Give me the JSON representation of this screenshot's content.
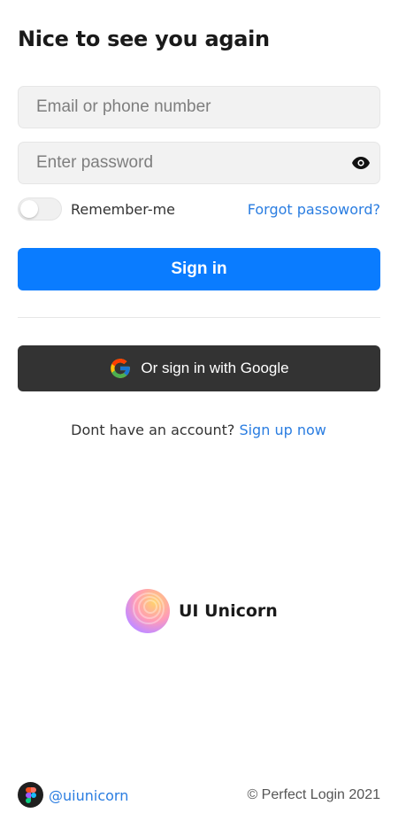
{
  "title": "Nice to see you again",
  "form": {
    "email_placeholder": "Email or phone number",
    "email_value": "",
    "password_placeholder": "Enter password",
    "password_value": "",
    "remember_label": "Remember-me",
    "remember_checked": false,
    "forgot_label": "Forgot passoword?",
    "signin_label": "Sign in",
    "google_label": "Or sign in with Google"
  },
  "signup": {
    "prompt": "Dont have an account?",
    "link": "Sign up now"
  },
  "brand": {
    "name": "UI Unicorn"
  },
  "footer": {
    "handle": "@uiunicorn",
    "copyright": "© Perfect Login 2021"
  },
  "colors": {
    "primary": "#0a7cff",
    "link": "#2a7de1",
    "google_button": "#333333",
    "field_bg": "#f2f2f2"
  },
  "icons": {
    "password_toggle": "eye-icon",
    "google": "google-g-icon",
    "brand": "ui-unicorn-logo",
    "social": "figma-icon"
  }
}
